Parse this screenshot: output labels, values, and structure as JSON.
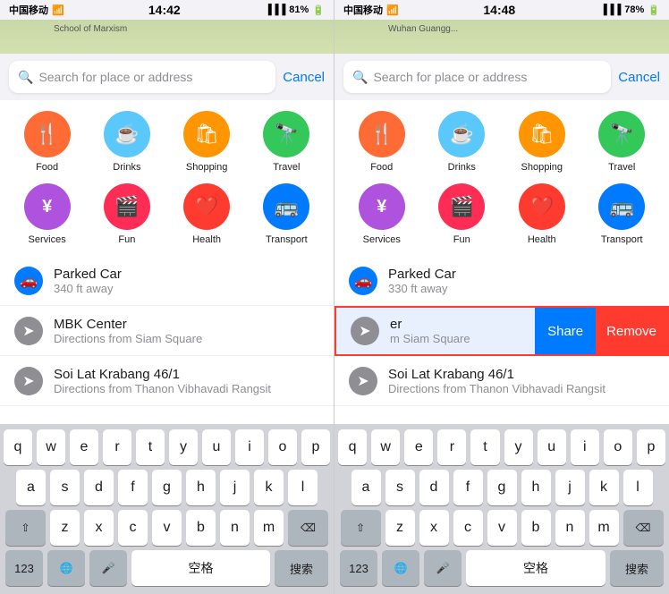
{
  "panels": [
    {
      "id": "left",
      "statusBar": {
        "carrier": "中国移动",
        "time": "14:42",
        "signal": "▐▐▐",
        "battery": "81%"
      },
      "searchBar": {
        "placeholder": "Search for place or address",
        "cancelLabel": "Cancel"
      },
      "categories": [
        {
          "id": "food",
          "label": "Food",
          "icon": "🍴",
          "color": "orange"
        },
        {
          "id": "drinks",
          "label": "Drinks",
          "icon": "☕",
          "color": "blue-light"
        },
        {
          "id": "shopping",
          "label": "Shopping",
          "icon": "🛍",
          "color": "orange2"
        },
        {
          "id": "travel",
          "label": "Travel",
          "icon": "🔭",
          "color": "green"
        },
        {
          "id": "services",
          "label": "Services",
          "icon": "¥",
          "color": "purple"
        },
        {
          "id": "fun",
          "label": "Fun",
          "icon": "🎬",
          "color": "pink"
        },
        {
          "id": "health",
          "label": "Health",
          "icon": "❤",
          "color": "red"
        },
        {
          "id": "transport",
          "label": "Transport",
          "icon": "🚌",
          "color": "cyan"
        }
      ],
      "listItems": [
        {
          "id": "parked-car",
          "title": "Parked Car",
          "subtitle": "340 ft away",
          "iconType": "car"
        },
        {
          "id": "mbk",
          "title": "MBK Center",
          "subtitle": "Directions from Siam Square",
          "iconType": "arrow"
        },
        {
          "id": "soi-lat",
          "title": "Soi Lat Krabang 46/1",
          "subtitle": "Directions from Thanon Vibhavadi Rangsit",
          "iconType": "arrow"
        }
      ],
      "keyboard": {
        "rows": [
          [
            "q",
            "w",
            "e",
            "r",
            "t",
            "y",
            "u",
            "i",
            "o",
            "p"
          ],
          [
            "a",
            "s",
            "d",
            "f",
            "g",
            "h",
            "j",
            "k",
            "l"
          ],
          [
            "z",
            "x",
            "c",
            "v",
            "b",
            "n",
            "m"
          ],
          [
            "123",
            "🌐",
            "🎤",
            "空格",
            "搜索"
          ]
        ]
      }
    },
    {
      "id": "right",
      "statusBar": {
        "carrier": "中国移动",
        "time": "14:48",
        "signal": "▐▐▐",
        "battery": "78%"
      },
      "searchBar": {
        "placeholder": "Search for place or address",
        "cancelLabel": "Cancel"
      },
      "categories": [
        {
          "id": "food",
          "label": "Food",
          "icon": "🍴",
          "color": "orange"
        },
        {
          "id": "drinks",
          "label": "Drinks",
          "icon": "☕",
          "color": "blue-light"
        },
        {
          "id": "shopping",
          "label": "Shopping",
          "icon": "🛍",
          "color": "orange2"
        },
        {
          "id": "travel",
          "label": "Travel",
          "icon": "🔭",
          "color": "green"
        },
        {
          "id": "services",
          "label": "Services",
          "icon": "¥",
          "color": "purple"
        },
        {
          "id": "fun",
          "label": "Fun",
          "icon": "🎬",
          "color": "pink"
        },
        {
          "id": "health",
          "label": "Health",
          "icon": "❤",
          "color": "red"
        },
        {
          "id": "transport",
          "label": "Transport",
          "icon": "🚌",
          "color": "cyan"
        }
      ],
      "listItems": [
        {
          "id": "parked-car",
          "title": "Parked Car",
          "subtitle": "330 ft away",
          "iconType": "car",
          "swipe": false
        },
        {
          "id": "mbk",
          "title": "er",
          "subtitle": "m Siam Square",
          "iconType": "arrow",
          "swipe": true
        },
        {
          "id": "soi-lat",
          "title": "Soi Lat Krabang 46/1",
          "subtitle": "Directions from Thanon Vibhavadi Rangsit",
          "iconType": "arrow",
          "swipe": false
        }
      ],
      "swipeActions": {
        "shareLabel": "Share",
        "removeLabel": "Remove"
      },
      "keyboard": {
        "rows": [
          [
            "q",
            "w",
            "e",
            "r",
            "t",
            "y",
            "u",
            "i",
            "o",
            "p"
          ],
          [
            "a",
            "s",
            "d",
            "f",
            "g",
            "h",
            "j",
            "k",
            "l"
          ],
          [
            "z",
            "x",
            "c",
            "v",
            "b",
            "n",
            "m"
          ],
          [
            "123",
            "🌐",
            "🎤",
            "空格",
            "搜索"
          ]
        ]
      }
    }
  ],
  "colors": {
    "orange": "#ff6b35",
    "blue_light": "#5ac8fa",
    "orange2": "#ff9500",
    "green": "#34c759",
    "purple": "#af52de",
    "pink": "#ff2d55",
    "red": "#ff3b30",
    "cyan": "#007aff",
    "accent": "#007aff"
  }
}
